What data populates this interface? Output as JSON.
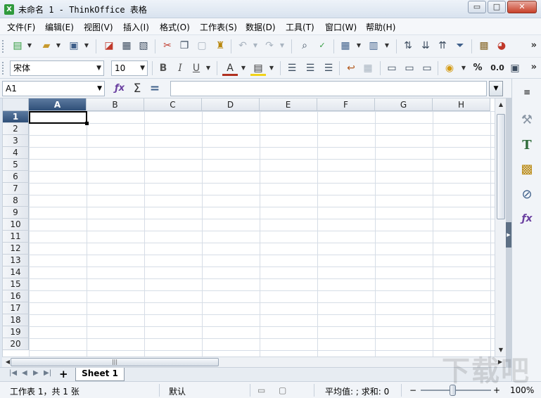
{
  "window": {
    "title": "未命名 1 - ThinkOffice 表格",
    "app_icon_glyph": "X",
    "minimize_glyph": "▭",
    "maximize_glyph": "□",
    "close_glyph": "✕"
  },
  "menu": {
    "items": [
      "文件(F)",
      "编辑(E)",
      "视图(V)",
      "插入(I)",
      "格式(O)",
      "工作表(S)",
      "数据(D)",
      "工具(T)",
      "窗口(W)",
      "帮助(H)"
    ]
  },
  "toolbar": {
    "more_glyph": "»",
    "font_name": "宋体",
    "font_size": "10",
    "bold_label": "B",
    "italic_label": "I",
    "underline_label": "U",
    "font_color_label": "A",
    "percent_label": "%",
    "decimal_label": "0.0"
  },
  "formula_bar": {
    "cell_ref": "A1",
    "sum_glyph": "Σ",
    "equals_glyph": "="
  },
  "grid": {
    "columns": [
      "A",
      "B",
      "C",
      "D",
      "E",
      "F",
      "G",
      "H"
    ],
    "rows": [
      "1",
      "2",
      "3",
      "4",
      "5",
      "6",
      "7",
      "8",
      "9",
      "10",
      "11",
      "12",
      "13",
      "14",
      "15",
      "16",
      "17",
      "18",
      "19",
      "20"
    ],
    "selected_column": "A",
    "selected_row": "1"
  },
  "sheets": {
    "add_label": "+",
    "tabs": [
      "Sheet 1"
    ]
  },
  "status": {
    "sheet_info": "工作表 1，共 1 张",
    "page_style": "默认",
    "summary": "平均值: ; 求和: 0",
    "zoom_out": "−",
    "zoom_in": "+",
    "zoom": "100%"
  },
  "watermark": "下载吧"
}
